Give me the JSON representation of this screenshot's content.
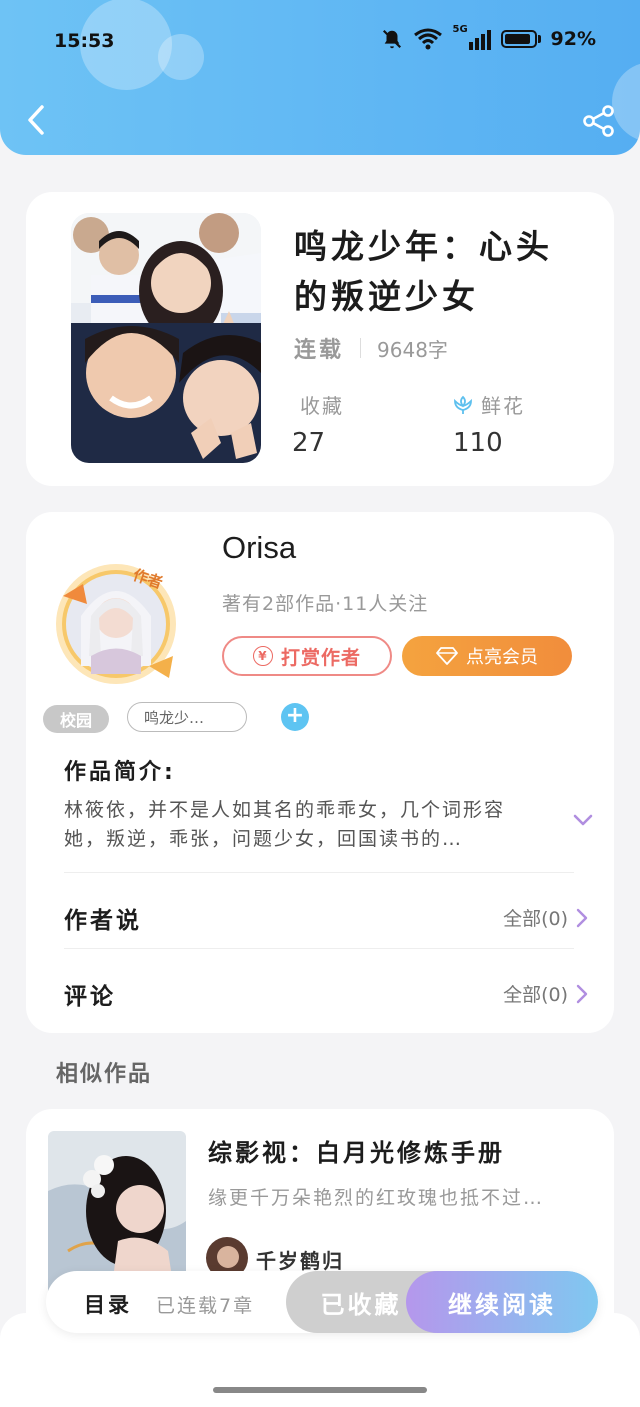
{
  "status_bar": {
    "time": "15:53",
    "network": "5G",
    "battery": "92%"
  },
  "book": {
    "title": "鸣龙少年：心头的叛逆少女",
    "status": "连载",
    "word_count": "9648字",
    "favorites_label": "收藏",
    "favorites_value": "27",
    "flowers_label": "鲜花",
    "flowers_value": "110"
  },
  "author": {
    "badge": "作者",
    "name": "Orisa",
    "info": "著有2部作品·11人关注",
    "reward_label": "打赏作者",
    "vip_label": "点亮会员"
  },
  "tags": {
    "category": "校园",
    "keyword": "鸣龙少…",
    "add": "+"
  },
  "intro": {
    "title": "作品简介:",
    "text": "林筱依，并不是人如其名的乖乖女，几个词形容她，叛逆，乖张，问题少女，回国读书的…"
  },
  "author_says": {
    "label": "作者说",
    "right": "全部(0)"
  },
  "comments": {
    "label": "评论",
    "right": "全部(0)"
  },
  "similar": {
    "section_title": "相似作品",
    "title": "综影视：白月光修炼手册",
    "desc": "缘更千万朵艳烈的红玫瑰也抵不过…",
    "author": "千岁鹤归_"
  },
  "action_bar": {
    "toc_label": "目录",
    "chapters": "已连载7章",
    "fav_label": "已收藏",
    "read_label": "继续阅读"
  },
  "colors": {
    "header": "#55aef2",
    "accent_orange": "#f18d3c",
    "accent_red": "#ec6a63"
  }
}
